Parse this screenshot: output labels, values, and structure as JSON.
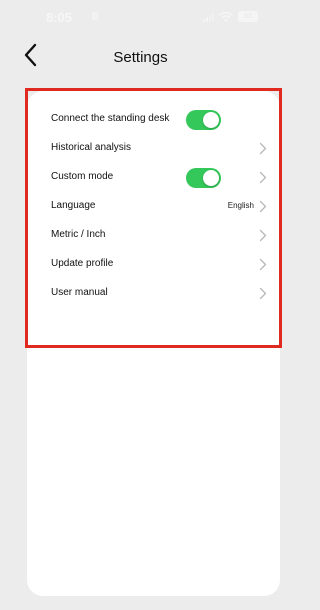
{
  "status_bar": {
    "time": "8:05",
    "battery": "53"
  },
  "nav": {
    "title": "Settings",
    "back_icon": "chevron-left-icon"
  },
  "colors": {
    "toggle_on": "#34c759",
    "highlight": "#e02a20",
    "background": "#ececec",
    "card": "#ffffff"
  },
  "settings": {
    "items": [
      {
        "label": "Connect the standing desk",
        "toggle_on": true
      },
      {
        "label": "Historical analysis"
      },
      {
        "label": "Custom mode",
        "toggle_on": true
      },
      {
        "label": "Language",
        "value": "English"
      },
      {
        "label": "Metric / Inch"
      },
      {
        "label": "Update profile"
      },
      {
        "label": "User manual"
      }
    ]
  }
}
